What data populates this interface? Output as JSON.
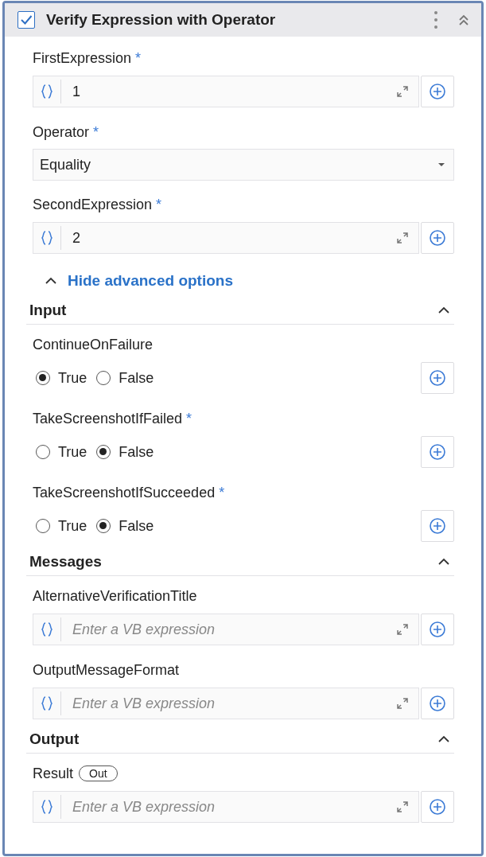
{
  "header": {
    "title": "Verify Expression with Operator",
    "checked": true
  },
  "fields": [
    {
      "kind": "expression",
      "label": "FirstExpression",
      "marker": "*",
      "value": "1"
    },
    {
      "kind": "dropdown",
      "label": "Operator",
      "marker": "*",
      "value": "Equality"
    },
    {
      "kind": "expression",
      "label": "SecondExpression",
      "marker": "*",
      "value": "2"
    }
  ],
  "advanced_toggle": {
    "label": "Hide advanced options",
    "expanded": true
  },
  "sections": [
    {
      "title": "Input",
      "expanded": true,
      "fields": [
        {
          "kind": "radio",
          "label": "ContinueOnFailure",
          "options": [
            {
              "label": "True",
              "selected": true
            },
            {
              "label": "False",
              "selected": false
            }
          ]
        },
        {
          "kind": "radio",
          "label": "TakeScreenshotIfFailed",
          "marker": "*",
          "options": [
            {
              "label": "True",
              "selected": false
            },
            {
              "label": "False",
              "selected": true
            }
          ]
        },
        {
          "kind": "radio",
          "label": "TakeScreenshotIfSucceeded",
          "marker": "*",
          "options": [
            {
              "label": "True",
              "selected": false
            },
            {
              "label": "False",
              "selected": true
            }
          ]
        }
      ]
    },
    {
      "title": "Messages",
      "expanded": true,
      "fields": [
        {
          "kind": "expression",
          "label": "AlternativeVerificationTitle",
          "placeholder": "Enter a VB expression"
        },
        {
          "kind": "expression",
          "label": "OutputMessageFormat",
          "placeholder": "Enter a VB expression"
        }
      ]
    },
    {
      "title": "Output",
      "expanded": true,
      "fields": [
        {
          "kind": "expression",
          "label": "Result",
          "badge": "Out",
          "placeholder": "Enter a VB expression"
        }
      ]
    }
  ]
}
